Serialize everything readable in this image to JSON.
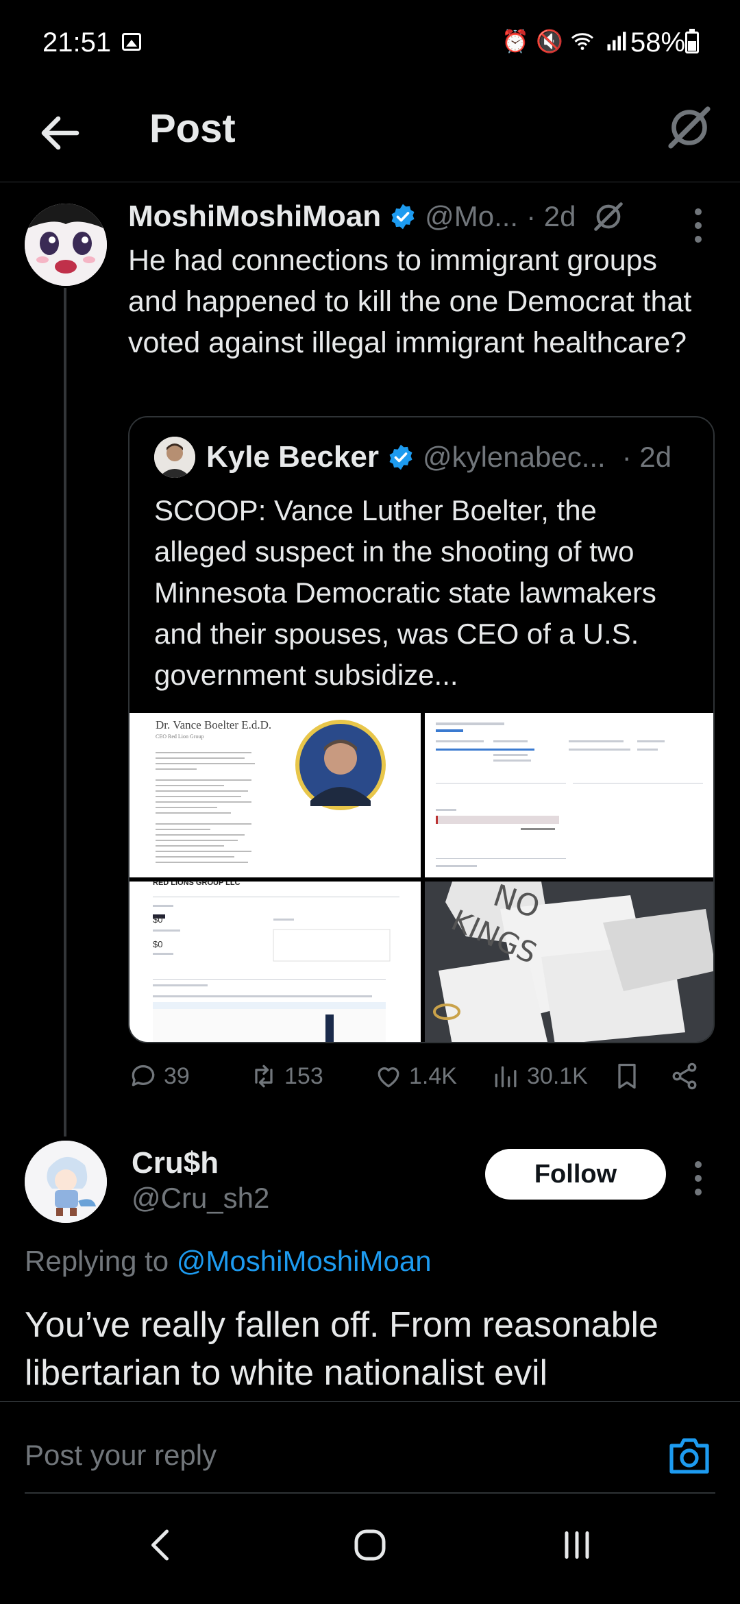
{
  "status_bar": {
    "time": "21:51",
    "battery": "58%"
  },
  "header": {
    "title": "Post"
  },
  "post": {
    "author_name": "MoshiMoshiMoan",
    "handle": "@Mo...",
    "time": "· 2d",
    "text": "He had connections to immigrant groups and happened to kill the one Democrat that voted against illegal immigrant healthcare?",
    "quote": {
      "author_name": "Kyle Becker",
      "handle": "@kylenabec...",
      "time": "· 2d",
      "text": "SCOOP: Vance Luther Boelter, the alleged suspect in the shooting of two Minnesota Democratic state lawmakers and their spouses, was CEO of a U.S. government subsidize...",
      "media": {
        "doc_title": "Dr. Vance Boelter E.d.D.",
        "doc_subtitle": "CEO Red Lion Group",
        "panel_title": "RED LIONS GROUP LLC",
        "sign_text_1": "NO",
        "sign_text_2": "KINGS",
        "amount_1": "$0",
        "amount_2": "$0"
      }
    },
    "stats": {
      "replies": "39",
      "reposts": "153",
      "likes": "1.4K",
      "views": "30.1K"
    }
  },
  "reply": {
    "author_name": "Cru$h",
    "handle": "@Cru_sh2",
    "follow_label": "Follow",
    "replying_prefix": "Replying to",
    "replying_to": "@MoshiMoshiMoan",
    "text": "You’ve really fallen off. From reasonable libertarian to white nationalist evil"
  },
  "composer": {
    "placeholder": "Post your reply"
  },
  "colors": {
    "accent": "#1d9bf0",
    "background": "#000000",
    "text": "#e7e9ea",
    "muted": "#71767b",
    "border": "#2f3336"
  }
}
